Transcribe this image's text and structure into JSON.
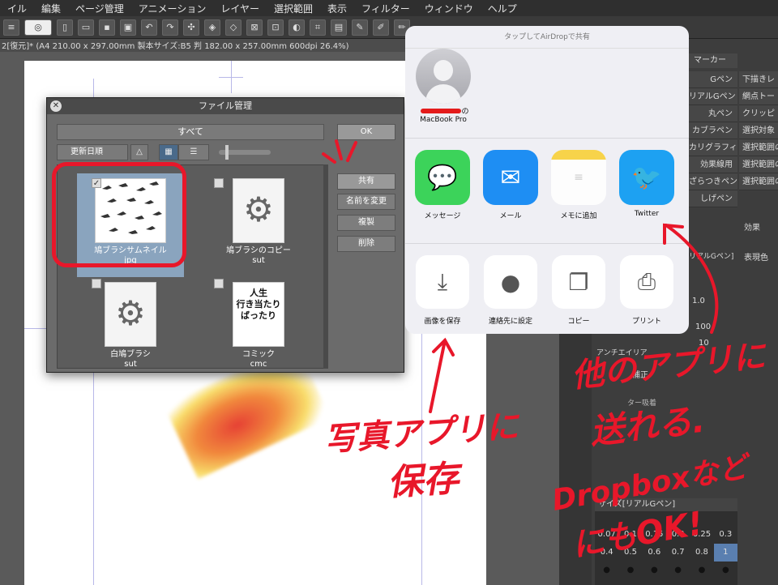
{
  "menubar": [
    "イル",
    "編集",
    "ページ管理",
    "アニメーション",
    "レイヤー",
    "選択範囲",
    "表示",
    "フィルター",
    "ウィンドウ",
    "ヘルプ"
  ],
  "doc_tab": "2[復元]* (A4 210.00 x 297.00mm 製本サイズ:B5 判 182.00 x 257.00mm 600dpi 26.4%)",
  "file_dialog": {
    "title": "ファイル管理",
    "filter": "すべて",
    "sort": "更新日順",
    "ok": "OK",
    "buttons": [
      "共有",
      "名前を変更",
      "複製",
      "削除"
    ],
    "files": [
      {
        "name": "鳩ブラシサムネイル",
        "ext": "jpg",
        "selected": true
      },
      {
        "name": "鳩ブラシのコピー",
        "ext": "sut",
        "selected": false
      },
      {
        "name": "白鳩ブラシ",
        "ext": "sut",
        "selected": false
      },
      {
        "name": "コミック",
        "ext": "cmc",
        "selected": false
      }
    ],
    "comic_thumb_text": [
      "人生",
      "行き当たり",
      "ばったり"
    ]
  },
  "share_sheet": {
    "header": "タップしてAirDropで共有",
    "airdrop_name_suffix": "の",
    "airdrop_device": "MacBook Pro",
    "apps": [
      {
        "label": "メッセージ",
        "color": "#3cd35a"
      },
      {
        "label": "メール",
        "color": "#1e8ef3"
      },
      {
        "label": "メモに追加",
        "color": "#f7d34a"
      },
      {
        "label": "Twitter",
        "color": "#1da1f2"
      }
    ],
    "actions": [
      {
        "label": "画像を保存"
      },
      {
        "label": "連絡先に設定"
      },
      {
        "label": "コピー"
      },
      {
        "label": "プリント"
      }
    ]
  },
  "right_panel": {
    "sub_tools": [
      "Gペン",
      "リアルGペン",
      "丸ペン",
      "カブラペン",
      "カリグラフィ",
      "効果線用",
      "ざらつきペン",
      "しげペン"
    ],
    "layer_props": [
      "下描きレ",
      "網点トー",
      "クリッピ",
      "選択対象",
      "選択範囲の",
      "選択範囲の",
      "選択範囲の"
    ],
    "label_marker": "マーカー",
    "label_effect": "効果",
    "label_display_color": "表現色",
    "label_antialias": "アンチエイリア",
    "label_correction": "補正",
    "label_layer": "ター吸着",
    "size_title": "サイズ[リアルGペン]",
    "sizes_row1": [
      "0.07",
      "0.1",
      "0.15",
      "0.2",
      "0.25",
      "0.3"
    ],
    "sizes_row2": [
      "0.4",
      "0.5",
      "0.6",
      "0.7",
      "0.8",
      "1"
    ],
    "gpen_label": "リアルGペン]",
    "val_1_0": "1.0",
    "val_100": "100",
    "val_10": "10"
  },
  "annotations": {
    "save_to_photos_1": "写真アプリに",
    "save_to_photos_2": "保存",
    "send_other_1": "他のアプリに",
    "send_other_2": "送れる.",
    "send_other_3": "Dropboxなど",
    "send_other_4": "にもOK!"
  },
  "colors": {
    "annotation_red": "#e8172a",
    "selected_bg": "#8aa4be"
  }
}
